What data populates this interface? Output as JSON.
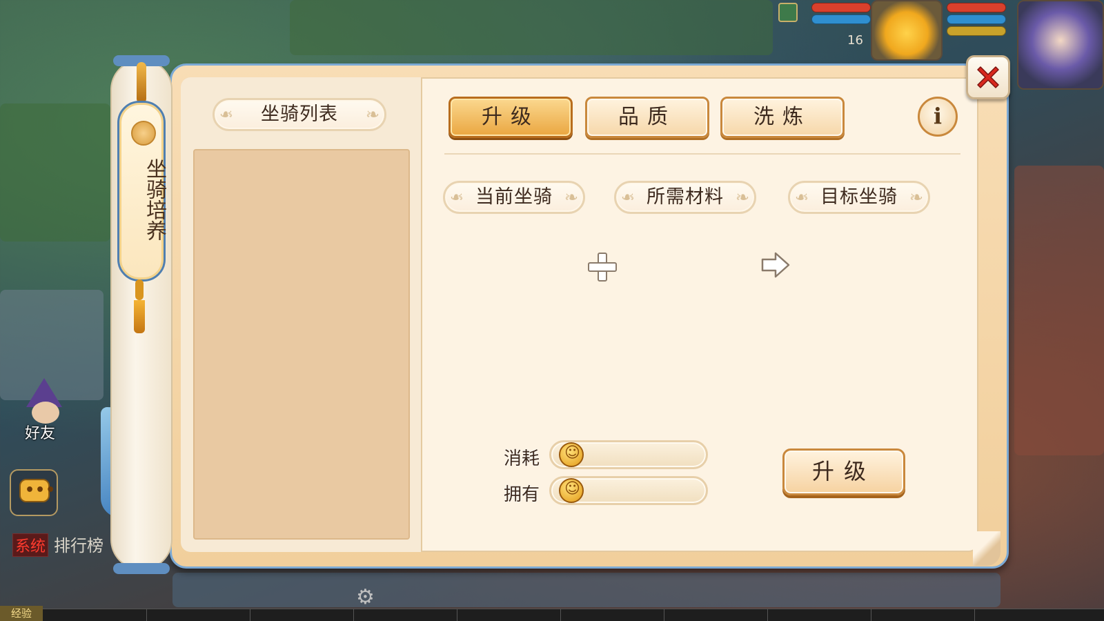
{
  "hud": {
    "player_level": "16",
    "hp_color": "#d9402c",
    "mp_color": "#2f8fd0"
  },
  "social": {
    "friend_label": "好友",
    "system_tag": "系统",
    "ranking_text": "排行榜",
    "exp_label": "经验"
  },
  "side_tab": {
    "label": "坐骑培养"
  },
  "panel": {
    "list_title": "坐骑列表",
    "tabs": [
      {
        "label": "升级",
        "active": true
      },
      {
        "label": "品质",
        "active": false
      },
      {
        "label": "洗炼",
        "active": false
      }
    ],
    "info_icon": "i",
    "current_mount_title": "当前坐骑",
    "materials_title": "所需材料",
    "target_mount_title": "目标坐骑",
    "cost": {
      "consume_label": "消耗",
      "consume_value": "",
      "own_label": "拥有",
      "own_value": ""
    },
    "upgrade_button": "升级"
  },
  "colors": {
    "panel_bg": "#fdf3e3",
    "panel_border": "#7ba9d4",
    "active_tab": "#eaa640",
    "close_x": "#d8281e"
  },
  "icons": [
    "plus-icon",
    "arrow-right-icon",
    "close-icon",
    "info-icon",
    "coin-icon",
    "chat-icon"
  ]
}
